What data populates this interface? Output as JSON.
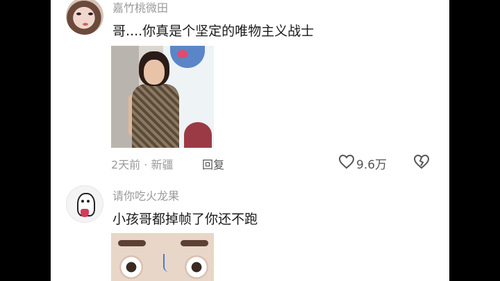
{
  "comments": [
    {
      "username": "嘉竹桃微田",
      "text": "哥....你真是个坚定的唯物主义战士",
      "time_location": "2天前 · 新疆",
      "reply_label": "回复",
      "likes": "9.6万"
    },
    {
      "username": "请你吃火龙果",
      "text": "小孩哥都掉帧了你还不跑"
    }
  ],
  "icons": {
    "like": "heart-outline-icon",
    "dislike": "broken-heart-icon"
  }
}
